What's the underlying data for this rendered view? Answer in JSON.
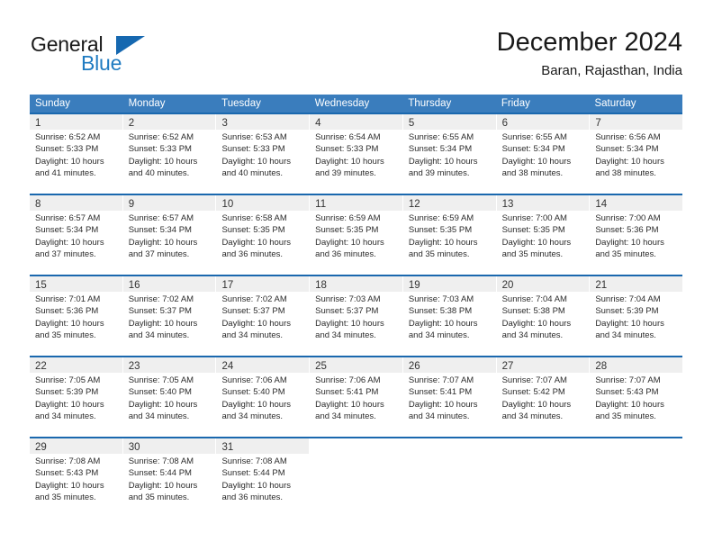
{
  "brand": {
    "name_part1": "General",
    "name_part2": "Blue",
    "triangle_icon": "triangle-icon"
  },
  "header": {
    "title": "December 2024",
    "subtitle": "Baran, Rajasthan, India"
  },
  "colors": {
    "header_blue": "#3a7dbd",
    "row_divider_blue": "#1a68ae",
    "day_band_gray": "#efefef",
    "brand_blue": "#1f7bc1",
    "text": "#2b2b2b"
  },
  "weekdays": [
    "Sunday",
    "Monday",
    "Tuesday",
    "Wednesday",
    "Thursday",
    "Friday",
    "Saturday"
  ],
  "weeks": [
    {
      "days": [
        {
          "num": "1",
          "sunrise": "Sunrise: 6:52 AM",
          "sunset": "Sunset: 5:33 PM",
          "daylight": "Daylight: 10 hours and 41 minutes."
        },
        {
          "num": "2",
          "sunrise": "Sunrise: 6:52 AM",
          "sunset": "Sunset: 5:33 PM",
          "daylight": "Daylight: 10 hours and 40 minutes."
        },
        {
          "num": "3",
          "sunrise": "Sunrise: 6:53 AM",
          "sunset": "Sunset: 5:33 PM",
          "daylight": "Daylight: 10 hours and 40 minutes."
        },
        {
          "num": "4",
          "sunrise": "Sunrise: 6:54 AM",
          "sunset": "Sunset: 5:33 PM",
          "daylight": "Daylight: 10 hours and 39 minutes."
        },
        {
          "num": "5",
          "sunrise": "Sunrise: 6:55 AM",
          "sunset": "Sunset: 5:34 PM",
          "daylight": "Daylight: 10 hours and 39 minutes."
        },
        {
          "num": "6",
          "sunrise": "Sunrise: 6:55 AM",
          "sunset": "Sunset: 5:34 PM",
          "daylight": "Daylight: 10 hours and 38 minutes."
        },
        {
          "num": "7",
          "sunrise": "Sunrise: 6:56 AM",
          "sunset": "Sunset: 5:34 PM",
          "daylight": "Daylight: 10 hours and 38 minutes."
        }
      ]
    },
    {
      "days": [
        {
          "num": "8",
          "sunrise": "Sunrise: 6:57 AM",
          "sunset": "Sunset: 5:34 PM",
          "daylight": "Daylight: 10 hours and 37 minutes."
        },
        {
          "num": "9",
          "sunrise": "Sunrise: 6:57 AM",
          "sunset": "Sunset: 5:34 PM",
          "daylight": "Daylight: 10 hours and 37 minutes."
        },
        {
          "num": "10",
          "sunrise": "Sunrise: 6:58 AM",
          "sunset": "Sunset: 5:35 PM",
          "daylight": "Daylight: 10 hours and 36 minutes."
        },
        {
          "num": "11",
          "sunrise": "Sunrise: 6:59 AM",
          "sunset": "Sunset: 5:35 PM",
          "daylight": "Daylight: 10 hours and 36 minutes."
        },
        {
          "num": "12",
          "sunrise": "Sunrise: 6:59 AM",
          "sunset": "Sunset: 5:35 PM",
          "daylight": "Daylight: 10 hours and 35 minutes."
        },
        {
          "num": "13",
          "sunrise": "Sunrise: 7:00 AM",
          "sunset": "Sunset: 5:35 PM",
          "daylight": "Daylight: 10 hours and 35 minutes."
        },
        {
          "num": "14",
          "sunrise": "Sunrise: 7:00 AM",
          "sunset": "Sunset: 5:36 PM",
          "daylight": "Daylight: 10 hours and 35 minutes."
        }
      ]
    },
    {
      "days": [
        {
          "num": "15",
          "sunrise": "Sunrise: 7:01 AM",
          "sunset": "Sunset: 5:36 PM",
          "daylight": "Daylight: 10 hours and 35 minutes."
        },
        {
          "num": "16",
          "sunrise": "Sunrise: 7:02 AM",
          "sunset": "Sunset: 5:37 PM",
          "daylight": "Daylight: 10 hours and 34 minutes."
        },
        {
          "num": "17",
          "sunrise": "Sunrise: 7:02 AM",
          "sunset": "Sunset: 5:37 PM",
          "daylight": "Daylight: 10 hours and 34 minutes."
        },
        {
          "num": "18",
          "sunrise": "Sunrise: 7:03 AM",
          "sunset": "Sunset: 5:37 PM",
          "daylight": "Daylight: 10 hours and 34 minutes."
        },
        {
          "num": "19",
          "sunrise": "Sunrise: 7:03 AM",
          "sunset": "Sunset: 5:38 PM",
          "daylight": "Daylight: 10 hours and 34 minutes."
        },
        {
          "num": "20",
          "sunrise": "Sunrise: 7:04 AM",
          "sunset": "Sunset: 5:38 PM",
          "daylight": "Daylight: 10 hours and 34 minutes."
        },
        {
          "num": "21",
          "sunrise": "Sunrise: 7:04 AM",
          "sunset": "Sunset: 5:39 PM",
          "daylight": "Daylight: 10 hours and 34 minutes."
        }
      ]
    },
    {
      "days": [
        {
          "num": "22",
          "sunrise": "Sunrise: 7:05 AM",
          "sunset": "Sunset: 5:39 PM",
          "daylight": "Daylight: 10 hours and 34 minutes."
        },
        {
          "num": "23",
          "sunrise": "Sunrise: 7:05 AM",
          "sunset": "Sunset: 5:40 PM",
          "daylight": "Daylight: 10 hours and 34 minutes."
        },
        {
          "num": "24",
          "sunrise": "Sunrise: 7:06 AM",
          "sunset": "Sunset: 5:40 PM",
          "daylight": "Daylight: 10 hours and 34 minutes."
        },
        {
          "num": "25",
          "sunrise": "Sunrise: 7:06 AM",
          "sunset": "Sunset: 5:41 PM",
          "daylight": "Daylight: 10 hours and 34 minutes."
        },
        {
          "num": "26",
          "sunrise": "Sunrise: 7:07 AM",
          "sunset": "Sunset: 5:41 PM",
          "daylight": "Daylight: 10 hours and 34 minutes."
        },
        {
          "num": "27",
          "sunrise": "Sunrise: 7:07 AM",
          "sunset": "Sunset: 5:42 PM",
          "daylight": "Daylight: 10 hours and 34 minutes."
        },
        {
          "num": "28",
          "sunrise": "Sunrise: 7:07 AM",
          "sunset": "Sunset: 5:43 PM",
          "daylight": "Daylight: 10 hours and 35 minutes."
        }
      ]
    },
    {
      "days": [
        {
          "num": "29",
          "sunrise": "Sunrise: 7:08 AM",
          "sunset": "Sunset: 5:43 PM",
          "daylight": "Daylight: 10 hours and 35 minutes."
        },
        {
          "num": "30",
          "sunrise": "Sunrise: 7:08 AM",
          "sunset": "Sunset: 5:44 PM",
          "daylight": "Daylight: 10 hours and 35 minutes."
        },
        {
          "num": "31",
          "sunrise": "Sunrise: 7:08 AM",
          "sunset": "Sunset: 5:44 PM",
          "daylight": "Daylight: 10 hours and 36 minutes."
        },
        {
          "num": "",
          "sunrise": "",
          "sunset": "",
          "daylight": ""
        },
        {
          "num": "",
          "sunrise": "",
          "sunset": "",
          "daylight": ""
        },
        {
          "num": "",
          "sunrise": "",
          "sunset": "",
          "daylight": ""
        },
        {
          "num": "",
          "sunrise": "",
          "sunset": "",
          "daylight": ""
        }
      ]
    }
  ]
}
